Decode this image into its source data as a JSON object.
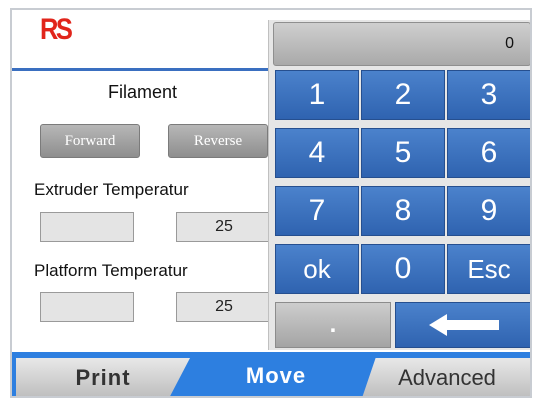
{
  "header": {
    "logo_text": "RS",
    "logo_color": "#e1251b",
    "accent_color": "#3a6fc0"
  },
  "move": {
    "filament_label": "Filament",
    "forward_label": "Forward",
    "reverse_label": "Reverse",
    "extruder_label": "Extruder Temperatur",
    "extruder_current": "25",
    "platform_label": "Platform Temperatur",
    "platform_current": "25"
  },
  "keypad": {
    "display_value": "0",
    "keys": [
      "1",
      "2",
      "3",
      "4",
      "5",
      "6",
      "7",
      "8",
      "9",
      "ok",
      "0",
      "Esc"
    ],
    "dot_label": ".",
    "backspace_icon": "left-arrow-icon",
    "key_color": "#3a70bd"
  },
  "tabs": {
    "print": "Print",
    "move": "Move",
    "advanced": "Advanced",
    "active": "Move",
    "bar_color": "#2d7fe0"
  }
}
